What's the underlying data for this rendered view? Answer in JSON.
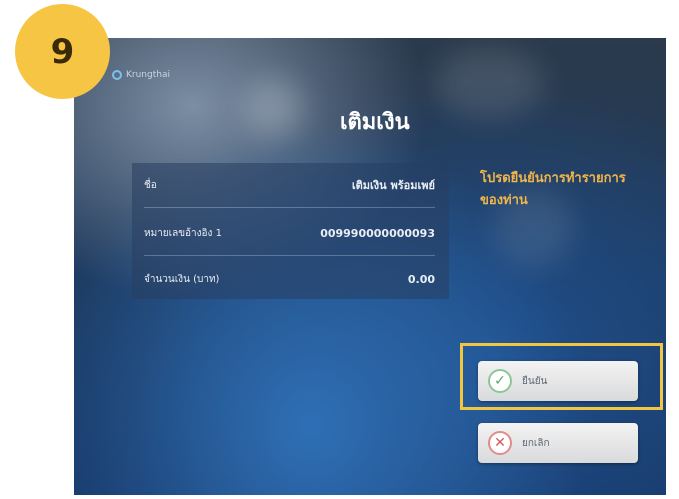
{
  "step": {
    "number": "9"
  },
  "brand": {
    "name": "Krungthai"
  },
  "screen": {
    "title": "เติมเงิน"
  },
  "info": {
    "rows": [
      {
        "label": "ชื่อ",
        "value": "เติมเงิน พร้อมเพย์"
      },
      {
        "label": "หมายเลขอ้างอิง 1",
        "value": "009990000000093"
      },
      {
        "label": "จำนวนเงิน (บาท)",
        "value": "0.00"
      }
    ]
  },
  "prompt": {
    "text": "โปรดยืนยันการทำรายการของท่าน"
  },
  "buttons": {
    "confirm_label": "ยืนยัน",
    "cancel_label": "ยกเลิก"
  },
  "colors": {
    "badge": "#f6c544",
    "highlight": "#f2c640",
    "prompt": "#f1b54a"
  }
}
